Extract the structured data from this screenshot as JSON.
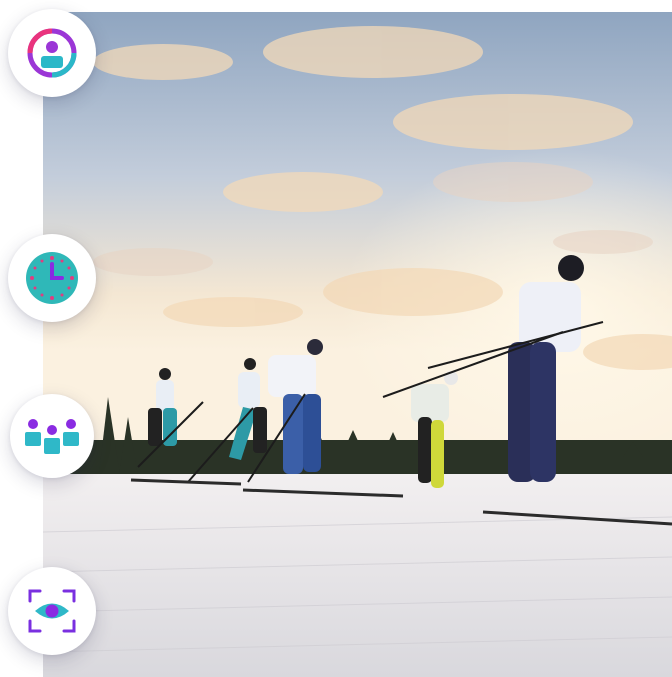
{
  "icons": [
    {
      "name": "user-refresh-icon",
      "colors": [
        "#9b36d6",
        "#e9347d",
        "#2bb8c8"
      ]
    },
    {
      "name": "clock-icon",
      "colors": [
        "#2fb8b8",
        "#8a2be2",
        "#e23b80"
      ]
    },
    {
      "name": "team-group-icon",
      "colors": [
        "#2fb8c8",
        "#8a2be2"
      ]
    },
    {
      "name": "eye-scan-icon",
      "colors": [
        "#7a2fe0",
        "#2fb8c8",
        "#8a2be2"
      ]
    }
  ],
  "photo": {
    "subject": "cross-country-skiers-racing",
    "colors": {
      "sky_top": "#8fa7c4",
      "sky_glow": "#f7e6c9",
      "snow": "#e6e4e6",
      "trees": "#2a3326"
    }
  }
}
